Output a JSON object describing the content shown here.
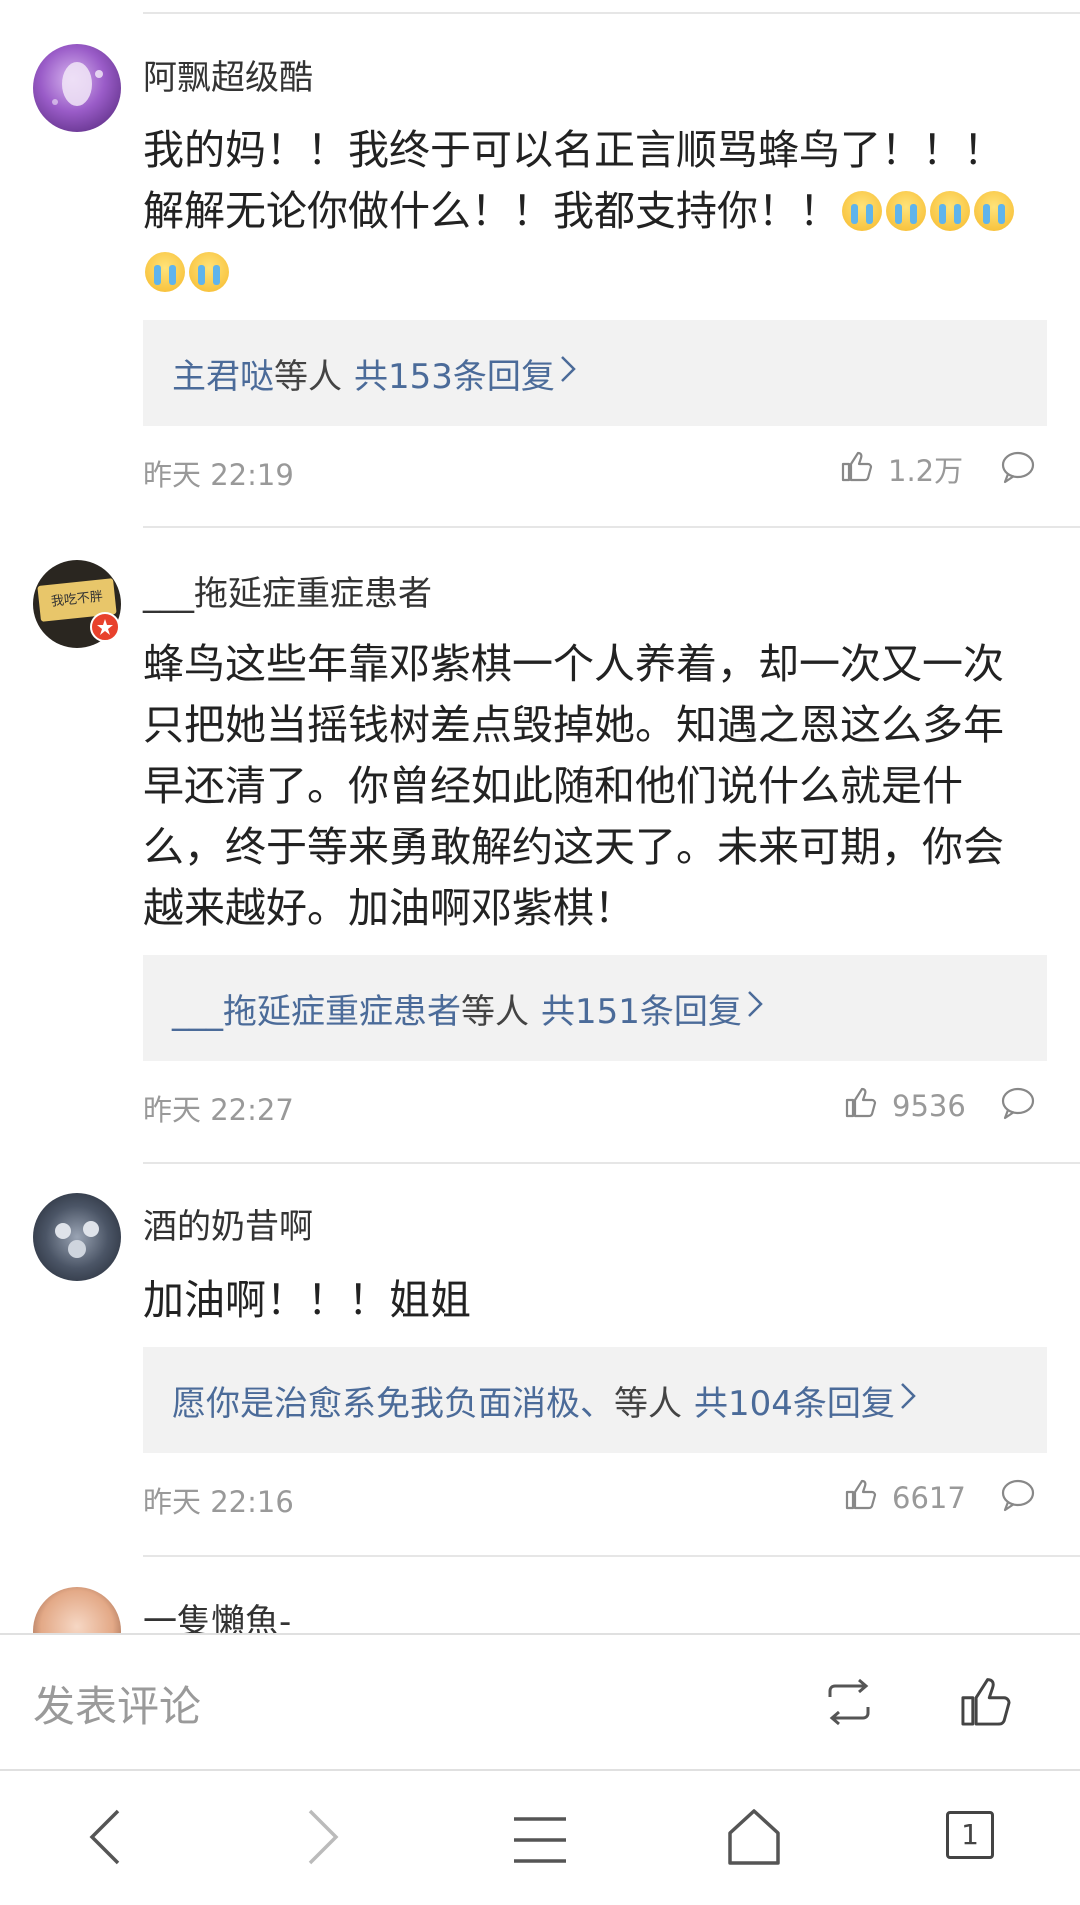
{
  "comments": [
    {
      "username": "阿飘超级酷",
      "text": "我的妈！！我终于可以名正言顺骂蜂鸟了！！！解解无论你做什么！！我都支持你！！",
      "emoji_count": 6,
      "emoji_name": "crying-emoji",
      "reply_users": "主君哒",
      "reply_suffix": "等人",
      "reply_count": "共153条回复",
      "time": "昨天 22:19",
      "likes": "1.2万"
    },
    {
      "username": "___拖延症重症患者",
      "text": "蜂鸟这些年靠邓紫棋一个人养着，却一次又一次只把她当摇钱树差点毁掉她。知遇之恩这么多年早还清了。你曾经如此随和他们说什么就是什么，终于等来勇敢解约这天了。未来可期，你会越来越好。加油啊邓紫棋！",
      "reply_users": "___拖延症重症患者",
      "reply_suffix": "等人",
      "reply_count": "共151条回复",
      "time": "昨天 22:27",
      "likes": "9536",
      "avatar_text": "我吃不胖"
    },
    {
      "username": "酒的奶昔啊",
      "text": "加油啊！！！姐姐",
      "reply_users": "愿你是治愈系免我负面消极、",
      "reply_suffix": "等人",
      "reply_count": "共104条回复",
      "time": "昨天 22:16",
      "likes": "6617"
    },
    {
      "username": "一隻懶魚-"
    }
  ],
  "input_bar": {
    "placeholder": "发表评论"
  },
  "nav": {
    "tab_count": "1"
  },
  "icons": {
    "like": "thumbs-up-icon",
    "comment": "comment-bubble-icon",
    "repost": "repost-icon",
    "back": "back-arrow-icon",
    "forward": "forward-arrow-icon",
    "menu": "menu-icon",
    "home": "home-icon",
    "tabs": "tabs-icon"
  },
  "colors": {
    "link_blue": "#4b6b99",
    "meta_gray": "#999999",
    "reply_bg": "#f2f2f2"
  }
}
